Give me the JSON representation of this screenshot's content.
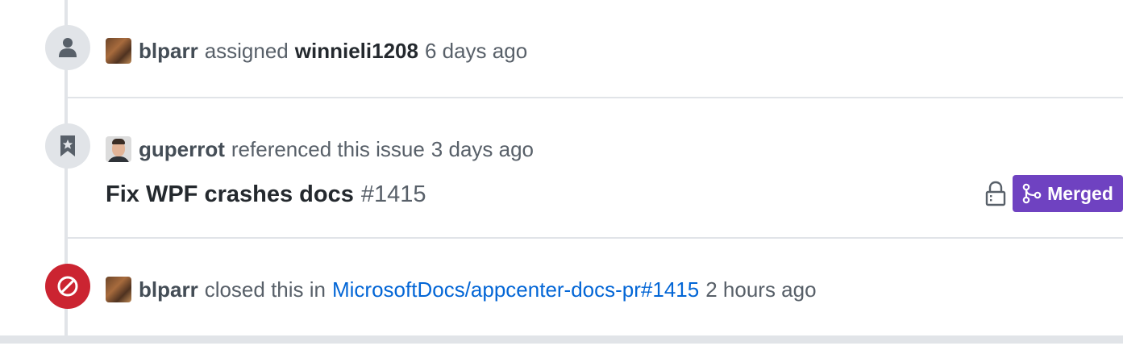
{
  "timeline": {
    "events": [
      {
        "type": "assigned",
        "icon": "person-icon",
        "actor": "blparr",
        "action": "assigned",
        "assignee": "winnieli1208",
        "time": "6 days ago"
      },
      {
        "type": "referenced",
        "icon": "bookmark-icon",
        "actor": "guperrot",
        "action": "referenced this issue",
        "time": "3 days ago",
        "reference": {
          "title": "Fix WPF crashes docs",
          "number": "#1415",
          "status": "Merged",
          "status_color": "#6f42c1",
          "lock_icon": "lock-icon"
        }
      },
      {
        "type": "closed",
        "icon": "circle-slash-icon",
        "icon_color": "#cb2431",
        "actor": "blparr",
        "action": "closed this in",
        "link": "MicrosoftDocs/appcenter-docs-pr#1415",
        "time": "2 hours ago"
      }
    ]
  },
  "colors": {
    "link": "#0366d6",
    "merged": "#6f42c1",
    "closed": "#cb2431",
    "timeline": "#e1e4e8"
  }
}
